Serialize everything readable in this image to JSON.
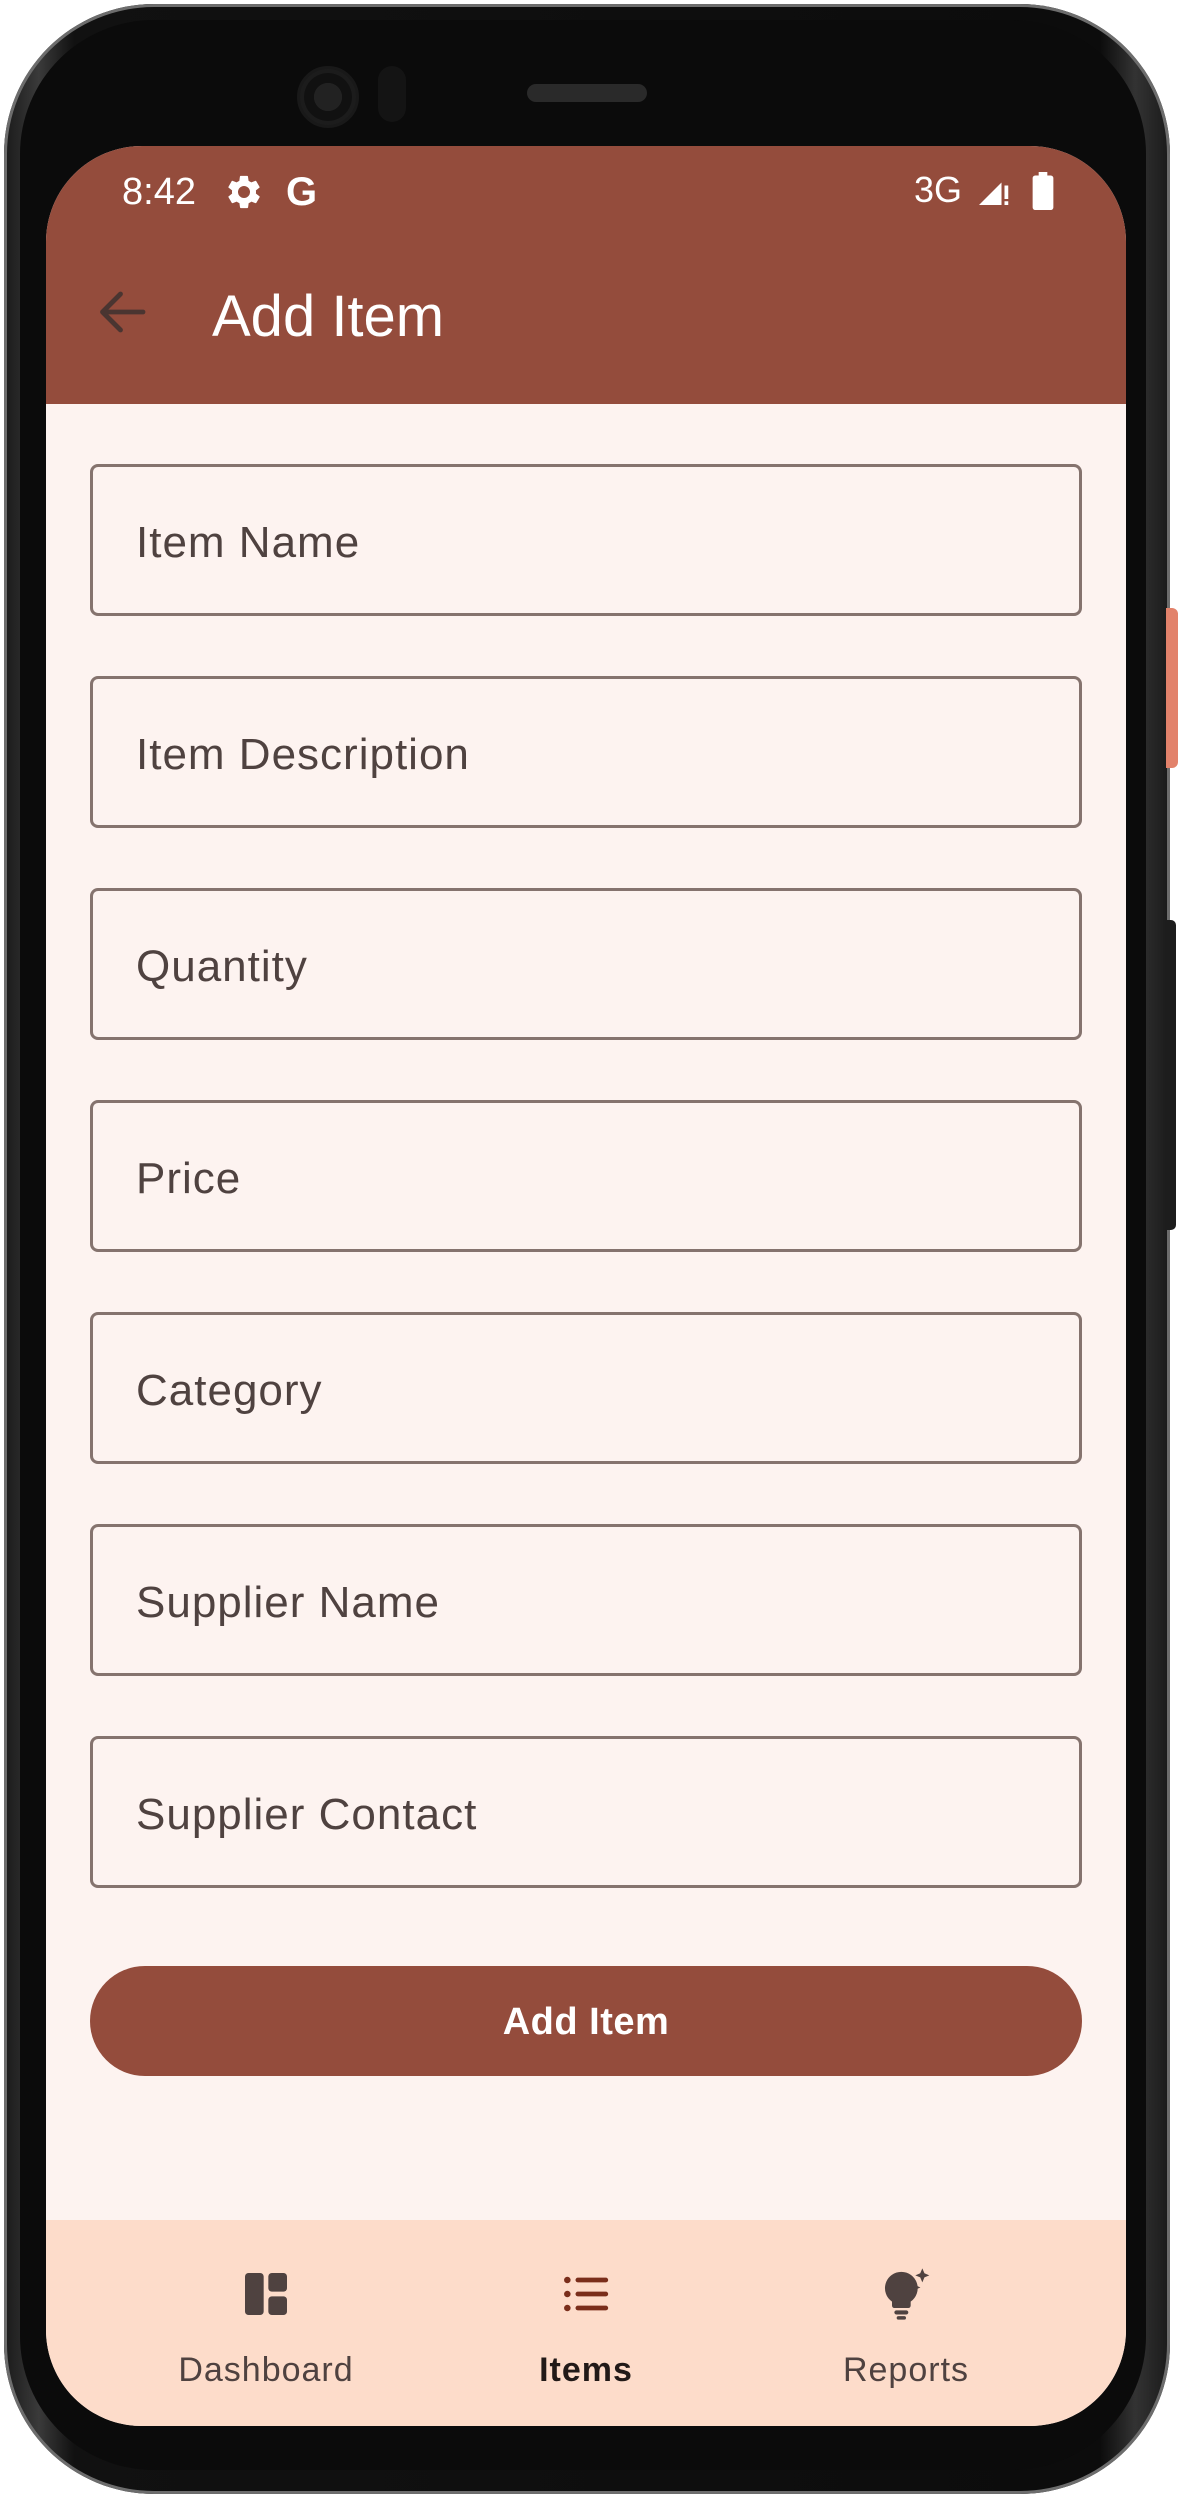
{
  "status_bar": {
    "time": "8:42",
    "google_letter": "G",
    "network": "3G",
    "icons": [
      "gear-icon",
      "signal-icon",
      "battery-icon"
    ]
  },
  "app_bar": {
    "title": "Add Item",
    "back_icon": "arrow-back-icon"
  },
  "form": {
    "fields": [
      {
        "placeholder": "Item Name",
        "value": ""
      },
      {
        "placeholder": "Item Description",
        "value": ""
      },
      {
        "placeholder": "Quantity",
        "value": ""
      },
      {
        "placeholder": "Price",
        "value": ""
      },
      {
        "placeholder": "Category",
        "value": ""
      },
      {
        "placeholder": "Supplier Name",
        "value": ""
      },
      {
        "placeholder": "Supplier Contact",
        "value": ""
      }
    ],
    "submit_label": "Add Item"
  },
  "bottom_nav": {
    "items": [
      {
        "label": "Dashboard",
        "icon": "dashboard-icon",
        "active": false
      },
      {
        "label": "Items",
        "icon": "list-icon",
        "active": true
      },
      {
        "label": "Reports",
        "icon": "lightbulb-icon",
        "active": false
      }
    ]
  },
  "colors": {
    "primary": "#944c3c",
    "surface": "#fdf3f0",
    "nav_background": "#fddcca",
    "outline": "#85736e",
    "on_surface_variant": "#4f4240"
  }
}
